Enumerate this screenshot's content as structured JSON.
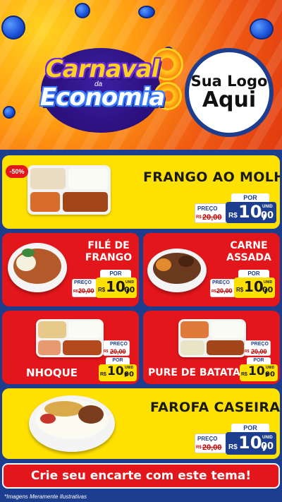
{
  "header": {
    "title_line1": "Carnaval",
    "title_small": "da",
    "title_line2": "Economia",
    "brand_line1": "Sua Logo",
    "brand_line2": "Aqui"
  },
  "products": [
    {
      "name": "FRANGO AO MOLHO",
      "badge": "-50%",
      "price_from_label": "PREÇO",
      "price_from": "20,00",
      "price_from_prefix": "R$",
      "price_by_label": "POR",
      "currency": "R$",
      "price_int": "10,",
      "price_cents": "00",
      "unit": "UNID"
    },
    {
      "name": "FILÉ DE FRANGO",
      "name_line1": "FILÉ DE",
      "name_line2": "FRANGO",
      "price_from_label": "PREÇO",
      "price_from": "20,00",
      "price_from_prefix": "R$",
      "price_by_label": "POR",
      "currency": "R$",
      "price_int": "10,",
      "price_cents": "00",
      "unit": "UNID"
    },
    {
      "name": "CARNE ASSADA",
      "name_line1": "CARNE",
      "name_line2": "ASSADA",
      "price_from_label": "PREÇO",
      "price_from": "20,00",
      "price_from_prefix": "R$",
      "price_by_label": "POR",
      "currency": "R$",
      "price_int": "10,",
      "price_cents": "00",
      "unit": "UNID"
    },
    {
      "name": "NHOQUE",
      "price_from_label": "PREÇO",
      "price_from": "20,00",
      "price_from_prefix": "R$",
      "price_by_label": "POR",
      "currency": "R$",
      "price_int": "10,",
      "price_cents": "00",
      "unit": "UNID"
    },
    {
      "name": "PURE DE BATATA",
      "price_from_label": "PREÇO",
      "price_from": "20,00",
      "price_from_prefix": "R$",
      "price_by_label": "POR",
      "currency": "R$",
      "price_int": "10,",
      "price_cents": "00",
      "unit": "UNID"
    },
    {
      "name": "FAROFA CASEIRA",
      "price_from_label": "PREÇO",
      "price_from": "20,00",
      "price_from_prefix": "R$",
      "price_by_label": "POR",
      "currency": "R$",
      "price_int": "10,",
      "price_cents": "00",
      "unit": "UNID"
    }
  ],
  "cta": "Crie seu encarte com este tema!",
  "footnote": "*Imagens Meramente Ilustrativas",
  "colors": {
    "navy": "#1d3d8f",
    "yellow": "#ffe100",
    "red": "#e3161b",
    "orange": "#f05a12"
  }
}
